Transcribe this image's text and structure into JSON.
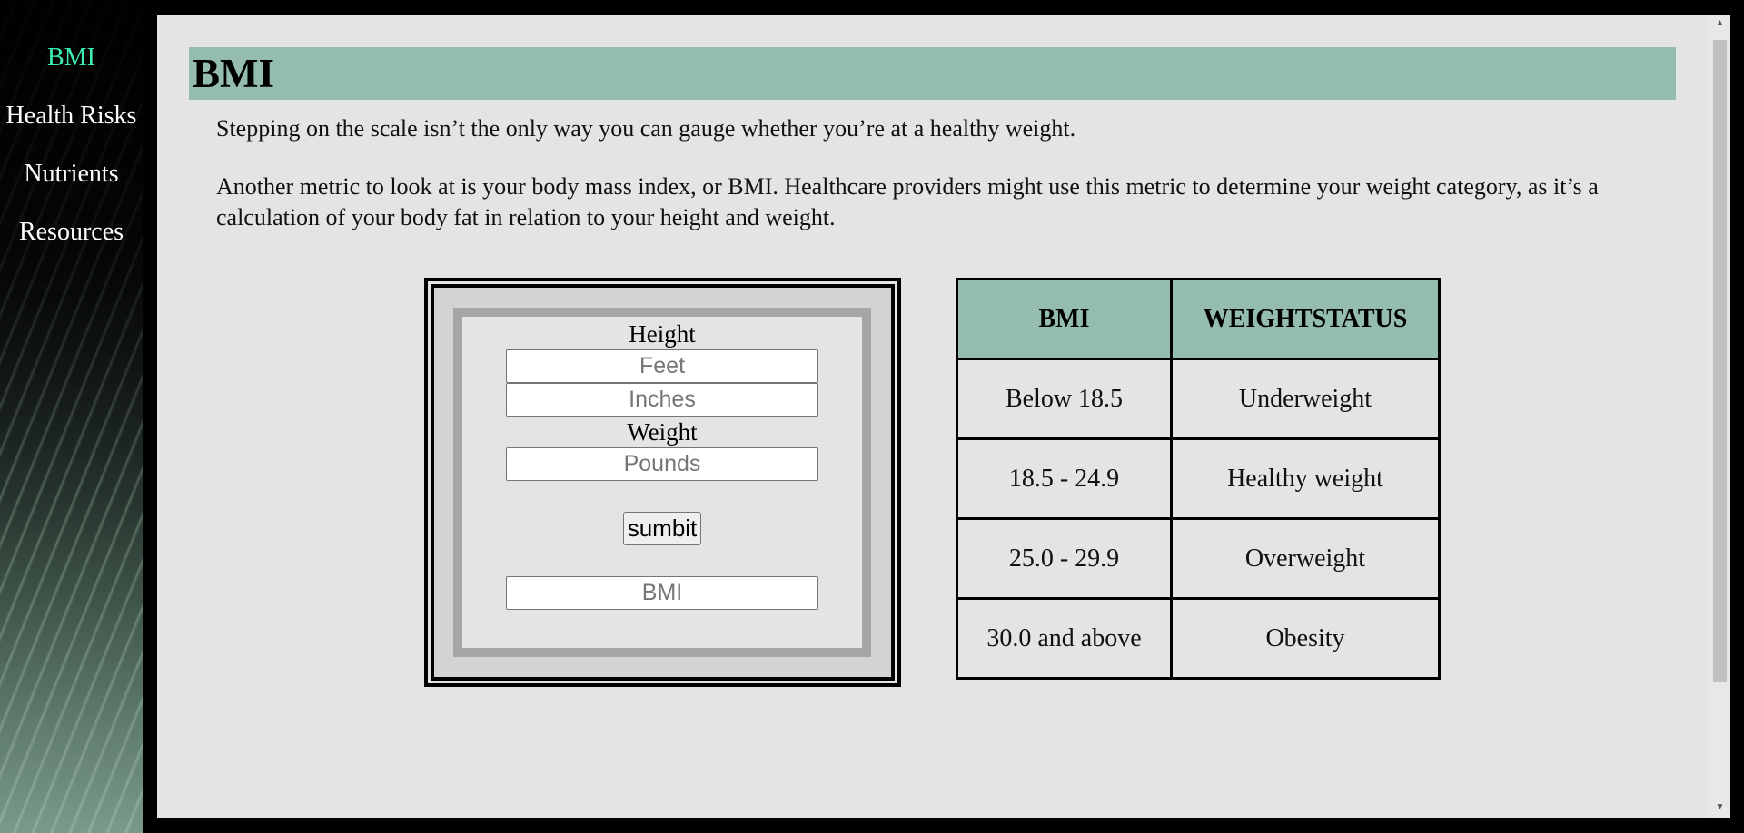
{
  "nav": {
    "items": [
      {
        "label": "BMI"
      },
      {
        "label": "Health Risks"
      },
      {
        "label": "Nutrients"
      },
      {
        "label": "Resources"
      }
    ]
  },
  "page": {
    "title": "BMI",
    "paragraph1": "Stepping on the scale isn’t the only way you can gauge whether you’re at a healthy weight.",
    "paragraph2": "Another metric to look at is your body mass index, or BMI. Healthcare providers might use this metric to determine your weight category, as it’s a calculation of your body fat in relation to your height and weight."
  },
  "form": {
    "height_label": "Height",
    "feet_placeholder": "Feet",
    "inches_placeholder": "Inches",
    "weight_label": "Weight",
    "pounds_placeholder": "Pounds",
    "submit_label": "sumbit",
    "bmi_placeholder": "BMI"
  },
  "table": {
    "headers": [
      "BMI",
      "WEIGHTSTATUS"
    ],
    "rows": [
      [
        "Below 18.5",
        "Underweight"
      ],
      [
        "18.5 - 24.9",
        "Healthy weight"
      ],
      [
        "25.0 - 29.9",
        "Overweight"
      ],
      [
        "30.0 and above",
        "Obesity"
      ]
    ]
  },
  "colors": {
    "accent": "#94bcb0",
    "active_nav": "#3cf0b5"
  }
}
